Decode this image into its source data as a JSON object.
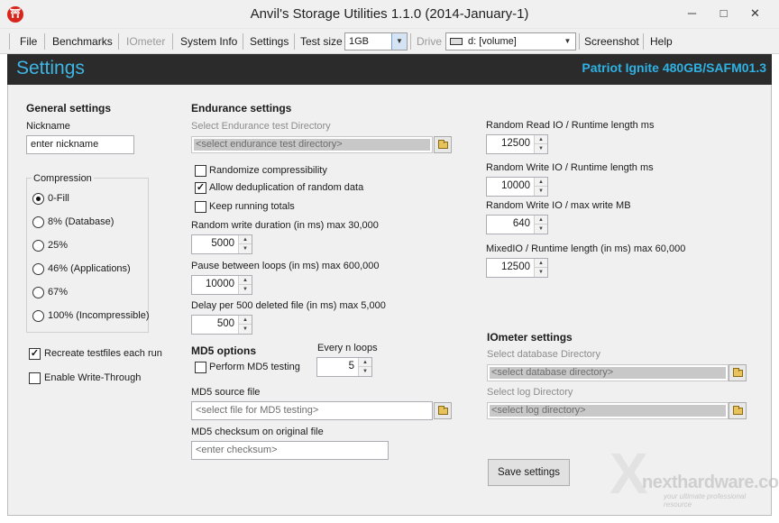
{
  "window": {
    "title": "Anvil's Storage Utilities 1.1.0 (2014-January-1)",
    "icon": "anvil-app-icon",
    "minimize": "─",
    "maximize": "□",
    "close": "✕"
  },
  "menu": {
    "file": "File",
    "benchmarks": "Benchmarks",
    "iometer": "IOmeter",
    "system_info": "System Info",
    "settings": "Settings",
    "test_size_label": "Test size",
    "test_size_value": "1GB",
    "drive_label": "Drive",
    "drive_value": "d: [volume]",
    "screenshot": "Screenshot",
    "help": "Help"
  },
  "header": {
    "title": "Settings",
    "device": "Patriot Ignite 480GB/SAFM01.3"
  },
  "general": {
    "heading": "General settings",
    "nickname_label": "Nickname",
    "nickname_value": "enter nickname",
    "compression_label": "Compression",
    "compression_options": [
      "0-Fill",
      "8% (Database)",
      "25%",
      "46% (Applications)",
      "67%",
      "100% (Incompressible)"
    ],
    "compression_selected": 0,
    "recreate_label": "Recreate testfiles each run",
    "recreate_checked": true,
    "write_through_label": "Enable Write-Through",
    "write_through_checked": false
  },
  "endurance": {
    "heading": "Endurance settings",
    "dir_label": "Select Endurance test Directory",
    "dir_placeholder": "<select endurance test directory>",
    "randomize_label": "Randomize compressibility",
    "randomize_checked": false,
    "dedup_label": "Allow deduplication of random data",
    "dedup_checked": true,
    "keep_totals_label": "Keep running totals",
    "keep_totals_checked": false,
    "random_write_label": "Random write duration (in ms) max 30,000",
    "random_write_value": "5000",
    "pause_label": "Pause between loops (in ms) max 600,000",
    "pause_value": "10000",
    "delay_label": "Delay per 500 deleted file (in ms) max 5,000",
    "delay_value": "500"
  },
  "md5": {
    "heading": "MD5 options",
    "every_label": "Every n loops",
    "every_value": "5",
    "perform_label": "Perform MD5 testing",
    "perform_checked": false,
    "source_label": "MD5 source file",
    "source_placeholder": "<select file for MD5 testing>",
    "checksum_label": "MD5 checksum on original file",
    "checksum_placeholder": "<enter checksum>"
  },
  "runtime": {
    "rr_label": "Random Read IO / Runtime length ms",
    "rr_value": "12500",
    "rw_label": "Random Write IO / Runtime length ms",
    "rw_value": "10000",
    "rw_max_label": "Random Write IO / max write MB",
    "rw_max_value": "640",
    "mixed_label": "MixedIO / Runtime length (in ms) max 60,000",
    "mixed_value": "12500"
  },
  "iometer_settings": {
    "heading": "IOmeter settings",
    "db_label": "Select database Directory",
    "db_placeholder": "<select database directory>",
    "log_label": "Select log Directory",
    "log_placeholder": "<select log directory>"
  },
  "actions": {
    "save": "Save settings"
  },
  "watermark": {
    "x": "X",
    "brand": "nexthardware.com",
    "tagline": "your ultimate professional resource"
  }
}
